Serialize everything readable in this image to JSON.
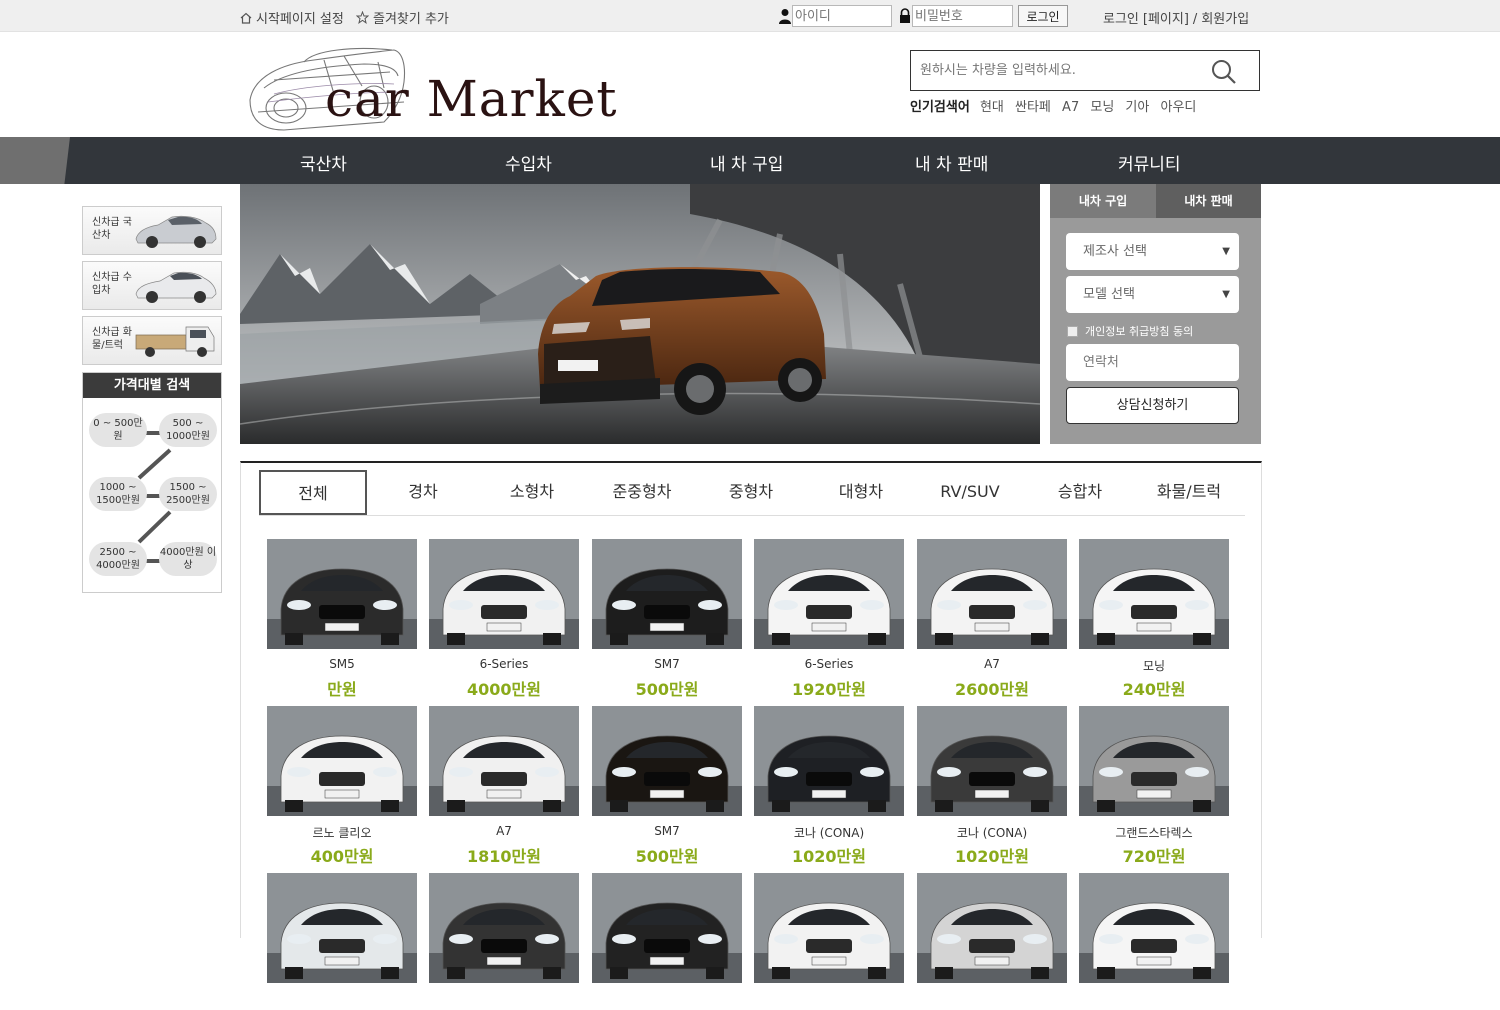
{
  "topbar": {
    "set_home": "시작페이지 설정",
    "favorite": "즐겨찾기 추가",
    "id_placeholder": "아이디",
    "pw_placeholder": "비밀번호",
    "login_button": "로그인",
    "right_links": [
      "로그인",
      "[페이지]",
      "/",
      "회원가입"
    ]
  },
  "header": {
    "logo_text": "car Market",
    "search_placeholder": "원하시는 차량을 입력하세요.",
    "popular_label": "인기검색어",
    "popular_keywords": [
      "현대",
      "싼타페",
      "A7",
      "모닝",
      "기아",
      "아우디"
    ]
  },
  "nav": {
    "items": [
      "국산차",
      "수입차",
      "내 차 구입",
      "내 차 판매",
      "커뮤니티"
    ]
  },
  "sidebar": {
    "cards": [
      {
        "label": "신차급 국산차"
      },
      {
        "label": "신차급 수입차"
      },
      {
        "label": "신차급 화물/트럭"
      }
    ],
    "price_title": "가격대별 검색",
    "price_ranges": [
      "0 ~ 500만원",
      "500 ~ 1000만원",
      "1000 ~ 1500만원",
      "1500 ~ 2500만원",
      "2500 ~ 4000만원",
      "4000만원 이상"
    ]
  },
  "consult": {
    "tab_buy": "내차 구입",
    "tab_sell": "내차 판매",
    "maker_select": "제조사 선택",
    "model_select": "모델 선택",
    "agree_label": "개인정보 취급방침 동의",
    "contact_placeholder": "연락처",
    "submit_label": "상담신청하기"
  },
  "categories": [
    "전체",
    "경차",
    "소형차",
    "준중형차",
    "중형차",
    "대형차",
    "RV/SUV",
    "승합차",
    "화물/트럭"
  ],
  "products": [
    {
      "name": "SM5",
      "price": "만원",
      "color": "#2b2b2b"
    },
    {
      "name": "6-Series",
      "price": "4000만원",
      "color": "#f1f1f1"
    },
    {
      "name": "SM7",
      "price": "500만원",
      "color": "#1d1d1d"
    },
    {
      "name": "6-Series",
      "price": "1920만원",
      "color": "#f4f4f4"
    },
    {
      "name": "A7",
      "price": "2600만원",
      "color": "#f3f3f3"
    },
    {
      "name": "모닝",
      "price": "240만원",
      "color": "#f5f5f5"
    },
    {
      "name": "르노 클리오",
      "price": "400만원",
      "color": "#f2f2f2"
    },
    {
      "name": "A7",
      "price": "1810만원",
      "color": "#f0f0f0"
    },
    {
      "name": "SM7",
      "price": "500만원",
      "color": "#1a1612"
    },
    {
      "name": "코나 (CONA)",
      "price": "1020만원",
      "color": "#1e2024"
    },
    {
      "name": "코나 (CONA)",
      "price": "1020만원",
      "color": "#3a3a3a"
    },
    {
      "name": "그랜드스타렉스",
      "price": "720만원",
      "color": "#9a9a9a"
    },
    {
      "name": "",
      "price": "",
      "color": "#e4e8ea"
    },
    {
      "name": "",
      "price": "",
      "color": "#333"
    },
    {
      "name": "",
      "price": "",
      "color": "#222"
    },
    {
      "name": "",
      "price": "",
      "color": "#f2f2f2"
    },
    {
      "name": "",
      "price": "",
      "color": "#d4d4d4"
    },
    {
      "name": "",
      "price": "",
      "color": "#f5f5f5"
    }
  ]
}
